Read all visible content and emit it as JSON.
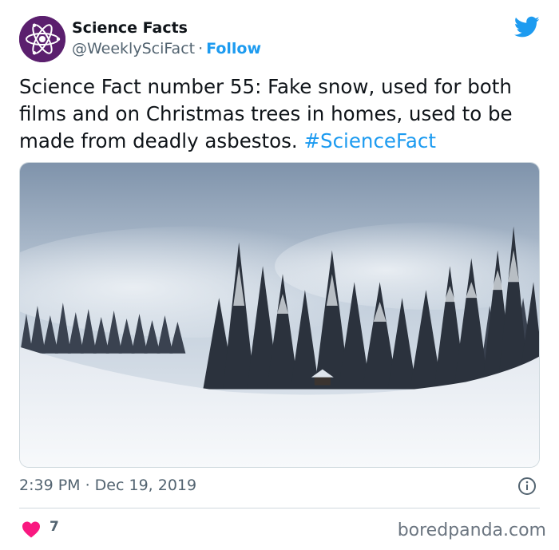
{
  "account": {
    "name": "Science Facts",
    "handle": "@WeeklySciFact",
    "separator": "·",
    "follow_label": "Follow"
  },
  "tweet": {
    "text": "Science Fact number 55: Fake snow, used for both films and on Christmas trees in homes, used to be made from deadly asbestos. ",
    "hashtag": "#ScienceFact"
  },
  "timestamp": "2:39 PM · Dec 19, 2019",
  "likes": {
    "count": "7"
  },
  "watermark": "boredpanda.com",
  "colors": {
    "accent": "#1d9bf0",
    "heart": "#f91880",
    "avatar_bg": "#5b1f6e"
  },
  "icons": {
    "avatar": "atom-icon",
    "brand": "twitter-bird-icon",
    "info": "info-icon",
    "like": "heart-icon"
  }
}
